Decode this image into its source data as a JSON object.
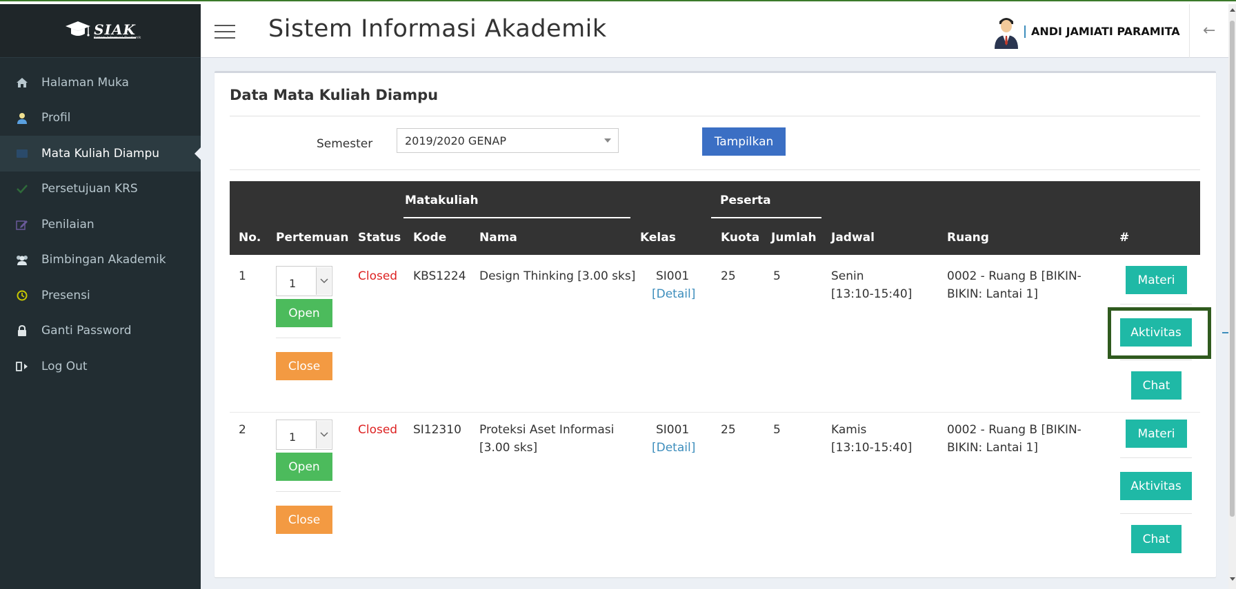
{
  "app": {
    "logo_text": "SIAK",
    "logo_subtext": "Sistem Informasi Akademik",
    "title": "Sistem Informasi Akademik",
    "user_name": "ANDI JAMIATI PARAMITA"
  },
  "sidebar": {
    "items": [
      {
        "label": "Halaman Muka",
        "icon": "home-icon"
      },
      {
        "label": "Profil",
        "icon": "user-icon"
      },
      {
        "label": "Mata Kuliah Diampu",
        "icon": "book-icon"
      },
      {
        "label": "Persetujuan KRS",
        "icon": "check-icon"
      },
      {
        "label": "Penilaian",
        "icon": "edit-icon"
      },
      {
        "label": "Bimbingan Akademik",
        "icon": "users-icon"
      },
      {
        "label": "Presensi",
        "icon": "clock-icon"
      },
      {
        "label": "Ganti Password",
        "icon": "lock-icon"
      },
      {
        "label": "Log Out",
        "icon": "logout-icon"
      }
    ],
    "active_index": 2
  },
  "main": {
    "box_title": "Data Mata Kuliah Diampu",
    "semester_label": "Semester",
    "semester_value": "2019/2020 GENAP",
    "show_button": "Tampilkan",
    "table": {
      "group_headers": {
        "matakuliah": "Matakuliah",
        "peserta": "Peserta"
      },
      "columns": {
        "no": "No.",
        "pertemuan": "Pertemuan",
        "status": "Status",
        "kode": "Kode",
        "nama": "Nama",
        "kelas": "Kelas",
        "kuota": "Kuota",
        "jumlah": "Jumlah",
        "jadwal": "Jadwal",
        "ruang": "Ruang",
        "action": "#"
      },
      "rows": [
        {
          "no": "1",
          "pertemuan": "1",
          "open_label": "Open",
          "close_label": "Close",
          "status": "Closed",
          "kode": "KBS1224",
          "nama_line1": "Design Thinking [3.00 sks]",
          "nama_line2": "",
          "kelas": "SI001",
          "detail": "[Detail]",
          "kuota": "25",
          "jumlah": "5",
          "jadwal_day": "Senin",
          "jadwal_time": "[13:10-15:40]",
          "ruang_line1": "0002 - Ruang B [BIKIN-",
          "ruang_line2": "BIKIN: Lantai 1]",
          "materi": "Materi",
          "aktivitas": "Aktivitas",
          "chat": "Chat"
        },
        {
          "no": "2",
          "pertemuan": "1",
          "open_label": "Open",
          "close_label": "Close",
          "status": "Closed",
          "kode": "SI12310",
          "nama_line1": "Proteksi Aset Informasi",
          "nama_line2": "[3.00 sks]",
          "kelas": "SI001",
          "detail": "[Detail]",
          "kuota": "25",
          "jumlah": "5",
          "jadwal_day": "Kamis",
          "jadwal_time": "[13:10-15:40]",
          "ruang_line1": "0002 - Ruang B [BIKIN-",
          "ruang_line2": "BIKIN: Lantai 1]",
          "materi": "Materi",
          "aktivitas": "Aktivitas",
          "chat": "Chat"
        }
      ]
    }
  },
  "colors": {
    "sidebar_bg": "#222d32",
    "header_table_bg": "#333333",
    "primary_button": "#3b6fc4",
    "open_button": "#4cbb5c",
    "close_button": "#f39a42",
    "teal_button": "#1fb9a6",
    "closed_status": "#dd2222",
    "highlight_border": "#2f5a1e"
  }
}
